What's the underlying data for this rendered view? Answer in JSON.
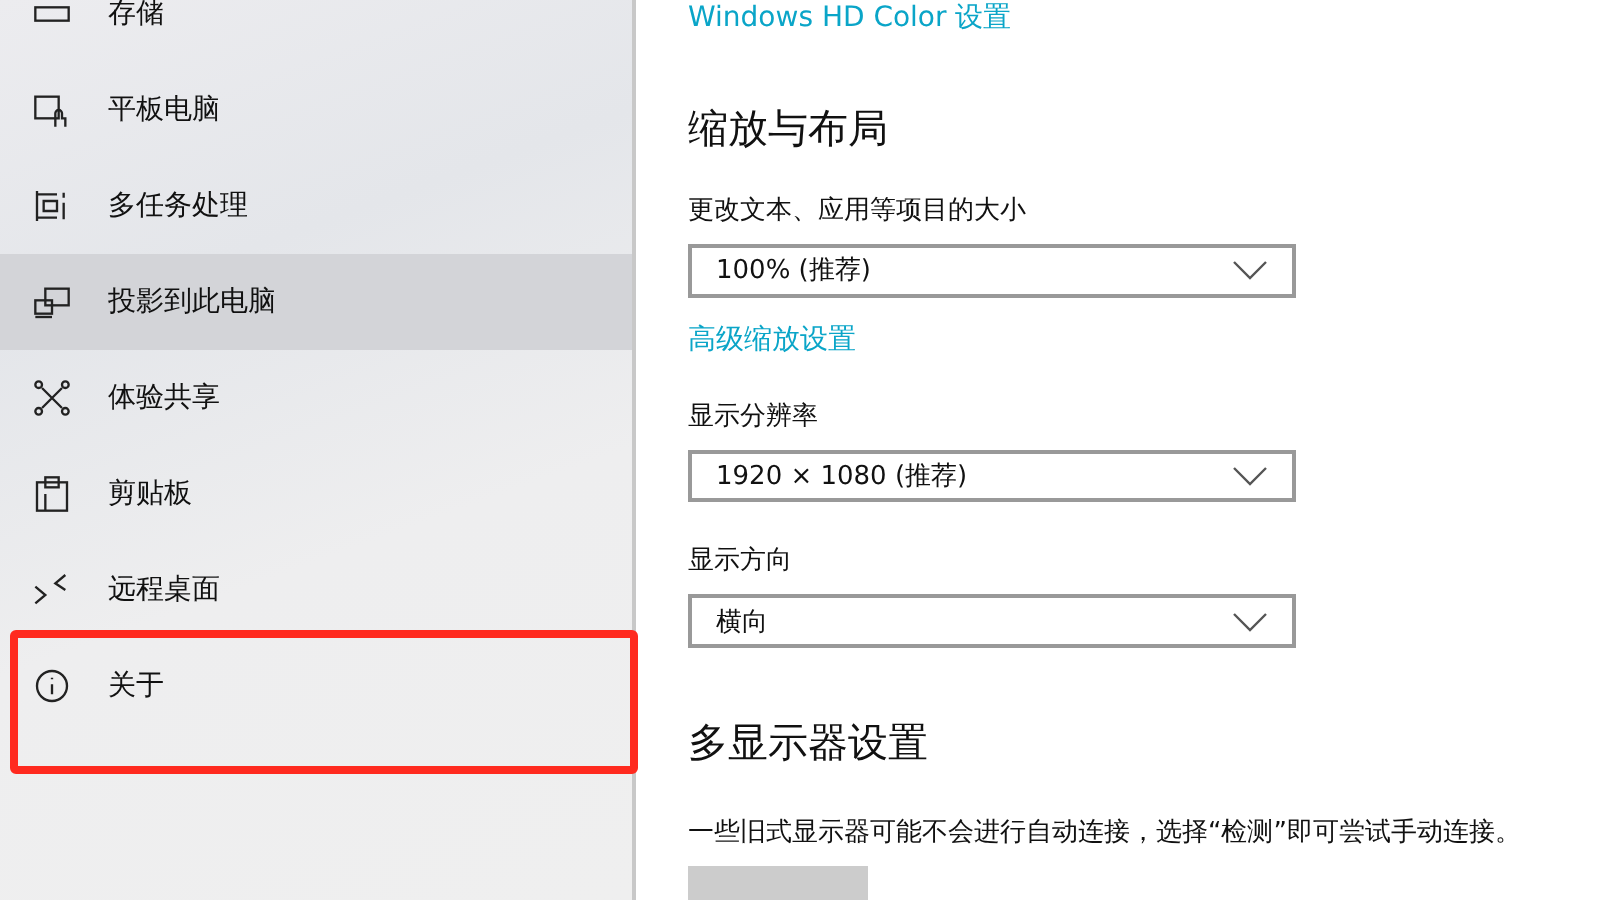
{
  "sidebar": {
    "items": [
      {
        "label": "存储",
        "selected": false,
        "annotated": false
      },
      {
        "label": "平板电脑",
        "selected": false,
        "annotated": false
      },
      {
        "label": "多任务处理",
        "selected": false,
        "annotated": false
      },
      {
        "label": "投影到此电脑",
        "selected": true,
        "annotated": false
      },
      {
        "label": "体验共享",
        "selected": false,
        "annotated": false
      },
      {
        "label": "剪贴板",
        "selected": false,
        "annotated": false
      },
      {
        "label": "远程桌面",
        "selected": false,
        "annotated": false
      },
      {
        "label": "关于",
        "selected": false,
        "annotated": true
      }
    ]
  },
  "content": {
    "top_link": "Windows HD Color 设置",
    "sections": [
      {
        "heading": "缩放与布局",
        "items": [
          {
            "kind": "dropdown",
            "label": "更改文本、应用等项目的大小",
            "value": "100% (推荐)"
          },
          {
            "kind": "link",
            "text": "高级缩放设置"
          },
          {
            "kind": "dropdown",
            "label": "显示分辨率",
            "value": "1920 × 1080 (推荐)"
          },
          {
            "kind": "dropdown",
            "label": "显示方向",
            "value": "横向"
          }
        ]
      },
      {
        "heading": "多显示器设置",
        "items": [
          {
            "kind": "text",
            "text": "一些旧式显示器可能不会进行自动连接，选择“检测”即可尝试手动连接。"
          },
          {
            "kind": "button"
          }
        ]
      }
    ]
  }
}
